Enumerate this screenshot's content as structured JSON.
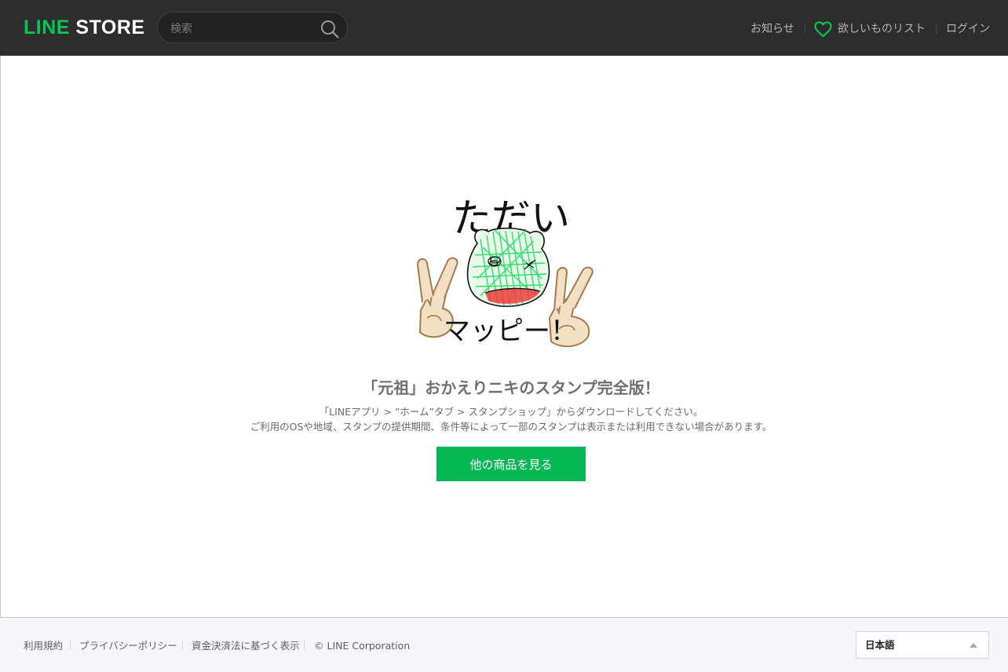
{
  "header": {
    "logo_part1": "LINE",
    "logo_part2": " STORE",
    "search_placeholder": "検索",
    "nav_notice": "お知らせ",
    "nav_wishlist": "欲しいものリスト",
    "nav_login": "ログイン"
  },
  "colors": {
    "brand_green": "#06c755",
    "header_bg": "#2d2d2d",
    "footer_bg": "#f6f6fb"
  },
  "main": {
    "sticker_text_top": "ただい",
    "sticker_text_bottom": "マッピー！",
    "title": "「元祖」おかえりニキのスタンプ完全版！",
    "note_line1": "「LINEアプリ > ”ホーム”タブ > スタンプショップ」からダウンロードしてください。",
    "note_line2": "ご利用のOSや地域、スタンプの提供期間、条件等によって一部のスタンプは表示または利用できない場合があります。",
    "cta_label": "他の商品を見る"
  },
  "footer": {
    "links": [
      "利用規約",
      "プライバシーポリシー",
      "資金決済法に基づく表示"
    ],
    "copyright": "© LINE Corporation",
    "language": "日本語"
  }
}
